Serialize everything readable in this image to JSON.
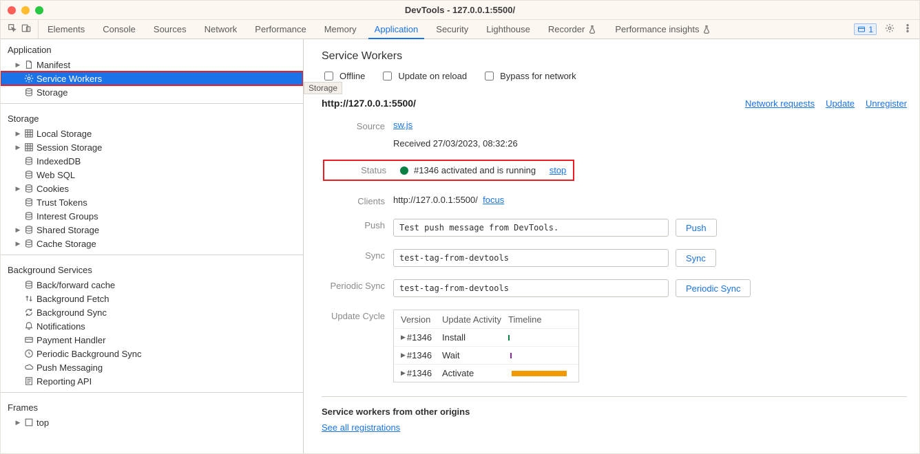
{
  "titlebar": {
    "title": "DevTools - 127.0.0.1:5500/"
  },
  "toolbar": {
    "tabs": [
      "Elements",
      "Console",
      "Sources",
      "Network",
      "Performance",
      "Memory",
      "Application",
      "Security",
      "Lighthouse",
      "Recorder",
      "Performance insights"
    ],
    "active_tab": "Application",
    "issues_badge": "1"
  },
  "sidebar": {
    "sections": {
      "application": {
        "title": "Application",
        "items": [
          {
            "label": "Manifest",
            "icon": "file",
            "caret": true
          },
          {
            "label": "Service Workers",
            "icon": "gear",
            "selected": true
          },
          {
            "label": "Storage",
            "icon": "db"
          }
        ]
      },
      "storage": {
        "title": "Storage",
        "items": [
          {
            "label": "Local Storage",
            "icon": "grid",
            "caret": true
          },
          {
            "label": "Session Storage",
            "icon": "grid",
            "caret": true
          },
          {
            "label": "IndexedDB",
            "icon": "db"
          },
          {
            "label": "Web SQL",
            "icon": "db"
          },
          {
            "label": "Cookies",
            "icon": "db",
            "caret": true
          },
          {
            "label": "Trust Tokens",
            "icon": "db"
          },
          {
            "label": "Interest Groups",
            "icon": "db"
          },
          {
            "label": "Shared Storage",
            "icon": "db",
            "caret": true
          },
          {
            "label": "Cache Storage",
            "icon": "db",
            "caret": true
          }
        ]
      },
      "bg": {
        "title": "Background Services",
        "items": [
          {
            "label": "Back/forward cache",
            "icon": "db"
          },
          {
            "label": "Background Fetch",
            "icon": "updown"
          },
          {
            "label": "Background Sync",
            "icon": "sync"
          },
          {
            "label": "Notifications",
            "icon": "bell"
          },
          {
            "label": "Payment Handler",
            "icon": "card"
          },
          {
            "label": "Periodic Background Sync",
            "icon": "clock"
          },
          {
            "label": "Push Messaging",
            "icon": "cloud"
          },
          {
            "label": "Reporting API",
            "icon": "report"
          }
        ]
      },
      "frames": {
        "title": "Frames",
        "items": [
          {
            "label": "top",
            "icon": "frame",
            "caret": true
          }
        ]
      }
    }
  },
  "panel": {
    "title": "Service Workers",
    "storage_tooltip": "Storage",
    "checkboxes": {
      "offline": "Offline",
      "update_reload": "Update on reload",
      "bypass": "Bypass for network"
    },
    "origin": "http://127.0.0.1:5500/",
    "links": {
      "network_requests": "Network requests",
      "update": "Update",
      "unregister": "Unregister"
    },
    "rows": {
      "source_label": "Source",
      "source_file": "sw.js",
      "received_text": "Received 27/03/2023, 08:32:26",
      "status_label": "Status",
      "status_text": "#1346 activated and is running",
      "status_action": "stop",
      "clients_label": "Clients",
      "clients_url": "http://127.0.0.1:5500/",
      "clients_action": "focus",
      "push_label": "Push",
      "push_value": "Test push message from DevTools.",
      "push_btn": "Push",
      "sync_label": "Sync",
      "sync_value": "test-tag-from-devtools",
      "sync_btn": "Sync",
      "psync_label": "Periodic Sync",
      "psync_value": "test-tag-from-devtools",
      "psync_btn": "Periodic Sync",
      "ucycle_label": "Update Cycle"
    },
    "update_cycle": {
      "headers": [
        "Version",
        "Update Activity",
        "Timeline"
      ],
      "rows": [
        {
          "version": "#1346",
          "activity": "Install",
          "bar": "install"
        },
        {
          "version": "#1346",
          "activity": "Wait",
          "bar": "wait"
        },
        {
          "version": "#1346",
          "activity": "Activate",
          "bar": "activate"
        }
      ]
    },
    "other_origins_title": "Service workers from other origins",
    "see_all": "See all registrations"
  }
}
